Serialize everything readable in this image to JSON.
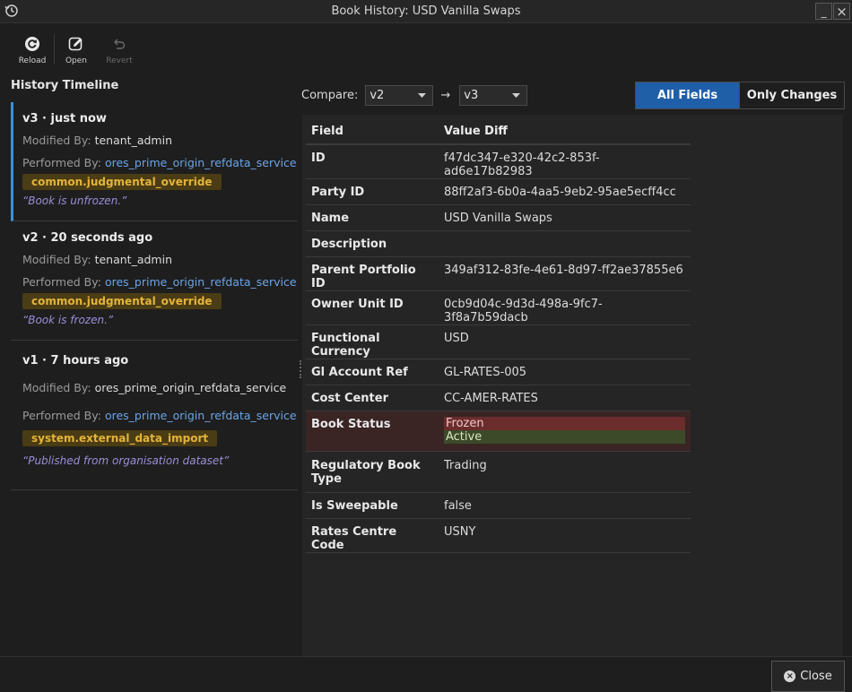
{
  "window": {
    "title": "Book History: USD Vanilla Swaps",
    "minimize_glyph": "_",
    "close_glyph": "×"
  },
  "toolbar": {
    "reload": "Reload",
    "open": "Open",
    "revert": "Revert"
  },
  "timeline": {
    "title": "History Timeline",
    "modified_label": "Modified By:",
    "performed_label": "Performed By:",
    "entries": [
      {
        "heading": "v3 · just now",
        "modified_by": "tenant_admin",
        "performed_by": "ores_prime_origin_refdata_service",
        "badge": "common.judgmental_override",
        "note": "“Book is unfrozen.”"
      },
      {
        "heading": "v2 · 20 seconds ago",
        "modified_by": "tenant_admin",
        "performed_by": "ores_prime_origin_refdata_service",
        "badge": "common.judgmental_override",
        "note": "“Book is frozen.”"
      },
      {
        "heading": "v1 · 7 hours ago",
        "modified_by": "ores_prime_origin_refdata_service",
        "performed_by": "ores_prime_origin_refdata_service",
        "badge": "system.external_data_import",
        "note": "“Published from organisation dataset”"
      }
    ]
  },
  "compare": {
    "label": "Compare:",
    "from": "v2",
    "arrow": "→",
    "to": "v3"
  },
  "view_toggle": {
    "all_fields": "All Fields",
    "only_changes": "Only Changes"
  },
  "diff": {
    "header_field": "Field",
    "header_value": "Value Diff",
    "rows": [
      {
        "field": "ID",
        "value": "f47dc347-e320-42c2-853f-ad6e17b82983"
      },
      {
        "field": "Party ID",
        "value": "88ff2af3-6b0a-4aa5-9eb2-95ae5ecff4cc"
      },
      {
        "field": "Name",
        "value": "USD Vanilla Swaps"
      },
      {
        "field": "Description",
        "value": ""
      },
      {
        "field": "Parent Portfolio ID",
        "value": "349af312-83fe-4e61-8d97-ff2ae37855e6"
      },
      {
        "field": "Owner Unit ID",
        "value": "0cb9d04c-9d3d-498a-9fc7-3f8a7b59dacb"
      },
      {
        "field": "Functional Currency",
        "value": "USD"
      },
      {
        "field": "Gl Account Ref",
        "value": "GL-RATES-005"
      },
      {
        "field": "Cost Center",
        "value": "CC-AMER-RATES"
      },
      {
        "field": "Book Status",
        "old_value": "Frozen",
        "new_value": "Active"
      },
      {
        "field": "Regulatory Book Type",
        "value": "Trading"
      },
      {
        "field": "Is Sweepable",
        "value": "false"
      },
      {
        "field": "Rates Centre Code",
        "value": "USNY"
      }
    ]
  },
  "footer": {
    "close": "Close"
  }
}
